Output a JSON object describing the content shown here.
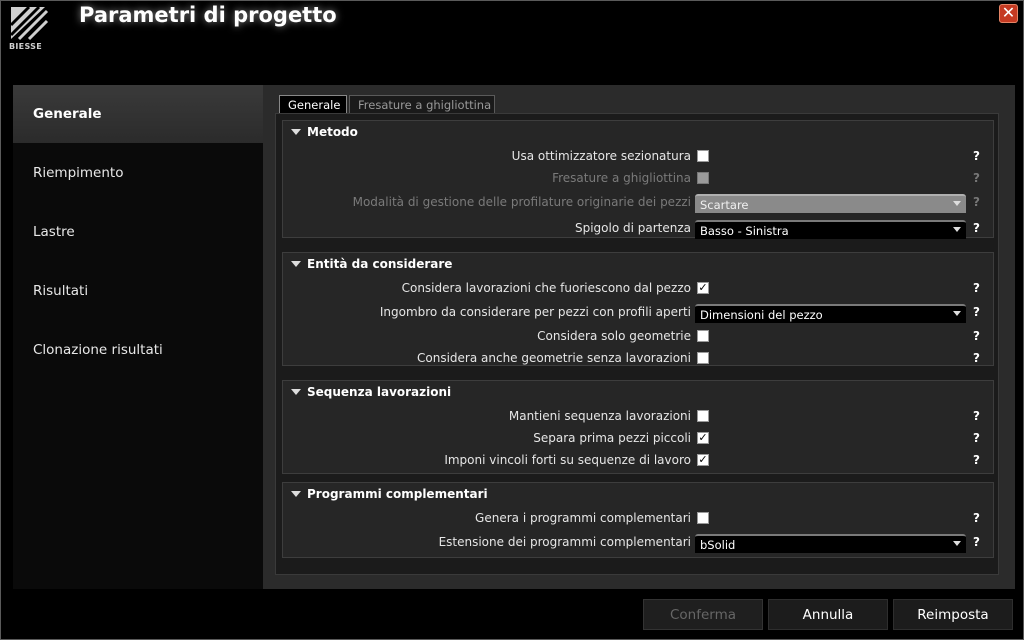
{
  "window": {
    "title": "Parametri di progetto",
    "logo_text": "BIESSE",
    "close_glyph": "✕"
  },
  "sidebar": {
    "items": [
      {
        "label": "Generale",
        "active": true
      },
      {
        "label": "Riempimento",
        "active": false
      },
      {
        "label": "Lastre",
        "active": false
      },
      {
        "label": "Risultati",
        "active": false
      },
      {
        "label": "Clonazione risultati",
        "active": false
      }
    ]
  },
  "tabs": [
    {
      "label": "Generale",
      "active": true
    },
    {
      "label": "Fresature a ghigliottina",
      "active": false
    }
  ],
  "groups": {
    "metodo": {
      "title": "Metodo",
      "rows": [
        {
          "label": "Usa ottimizzatore sezionatura",
          "type": "checkbox",
          "checked": false,
          "enabled": true,
          "help": "?"
        },
        {
          "label": "Fresature a ghigliottina",
          "type": "checkbox",
          "checked": false,
          "enabled": false,
          "help": "?"
        },
        {
          "label": "Modalità di gestione delle profilature originarie dei pezzi",
          "type": "select",
          "value": "Scartare",
          "enabled": false,
          "help": "?"
        },
        {
          "label": "Spigolo di partenza",
          "type": "select",
          "value": "Basso - Sinistra",
          "enabled": true,
          "help": "?"
        }
      ]
    },
    "entita": {
      "title": "Entità da considerare",
      "rows": [
        {
          "label": "Considera lavorazioni che fuoriescono dal pezzo",
          "type": "checkbox",
          "checked": true,
          "enabled": true,
          "help": "?"
        },
        {
          "label": "Ingombro da considerare per pezzi con profili aperti",
          "type": "select",
          "value": "Dimensioni del pezzo",
          "enabled": true,
          "help": "?"
        },
        {
          "label": "Considera solo geometrie",
          "type": "checkbox",
          "checked": false,
          "enabled": true,
          "help": "?"
        },
        {
          "label": "Considera anche geometrie senza lavorazioni",
          "type": "checkbox",
          "checked": false,
          "enabled": true,
          "help": "?"
        }
      ]
    },
    "sequenza": {
      "title": "Sequenza lavorazioni",
      "rows": [
        {
          "label": "Mantieni sequenza lavorazioni",
          "type": "checkbox",
          "checked": false,
          "enabled": true,
          "help": "?"
        },
        {
          "label": "Separa prima pezzi piccoli",
          "type": "checkbox",
          "checked": true,
          "enabled": true,
          "help": "?"
        },
        {
          "label": "Imponi vincoli forti su sequenze di lavoro",
          "type": "checkbox",
          "checked": true,
          "enabled": true,
          "help": "?"
        }
      ]
    },
    "programmi": {
      "title": "Programmi complementari",
      "rows": [
        {
          "label": "Genera i programmi complementari",
          "type": "checkbox",
          "checked": false,
          "enabled": true,
          "help": "?"
        },
        {
          "label": "Estensione dei programmi complementari",
          "type": "select",
          "value": "bSolid",
          "enabled": true,
          "help": "?"
        }
      ]
    }
  },
  "buttons": {
    "confirm": "Conferma",
    "cancel": "Annulla",
    "reset": "Reimposta"
  },
  "icons": {
    "check": "✓",
    "logo": "biesse-logo-icon",
    "close": "close-icon",
    "collapse": "triangle-down-icon",
    "dropdown": "chevron-down-icon",
    "help": "question-icon"
  },
  "colors": {
    "close_button": "#c53a22",
    "background": "#000000",
    "panel": "#262626"
  }
}
